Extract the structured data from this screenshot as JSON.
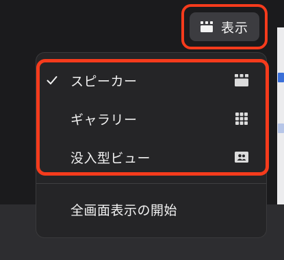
{
  "toolbar": {
    "view_button": {
      "label": "表示",
      "icon": "speaker-view-icon"
    }
  },
  "view_menu": {
    "items": [
      {
        "label": "スピーカー",
        "icon": "speaker-view-icon",
        "checked": true
      },
      {
        "label": "ギャラリー",
        "icon": "gallery-grid-icon",
        "checked": false
      },
      {
        "label": "没入型ビュー",
        "icon": "immersive-view-icon",
        "checked": false
      }
    ],
    "fullscreen_label": "全画面表示の開始"
  },
  "colors": {
    "highlight": "#f53b1c",
    "menu_bg": "#252527",
    "button_bg": "#3c3c40",
    "icon": "#dcdcdc"
  }
}
